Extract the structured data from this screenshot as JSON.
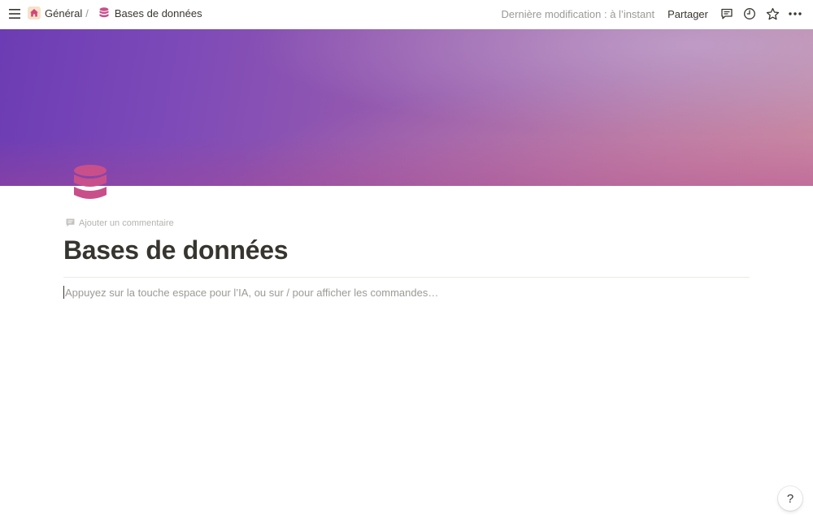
{
  "topbar": {
    "breadcrumb": [
      {
        "label": "Général",
        "icon": "home-icon"
      },
      {
        "label": "Bases de données",
        "icon": "database-icon"
      }
    ],
    "separator": "/",
    "last_edit": "Dernière modification : à l’instant",
    "share_label": "Partager"
  },
  "page": {
    "icon": "database-icon",
    "add_comment_label": "Ajouter un commentaire",
    "title": "Bases de données",
    "placeholder": "Appuyez sur la touche espace pour l’IA, ou sur / pour afficher les commandes…"
  },
  "help": {
    "label": "?"
  },
  "colors": {
    "accent_icon": "#c94f8a",
    "cover_start": "#6c3cb4",
    "cover_end": "#c08aa4"
  }
}
